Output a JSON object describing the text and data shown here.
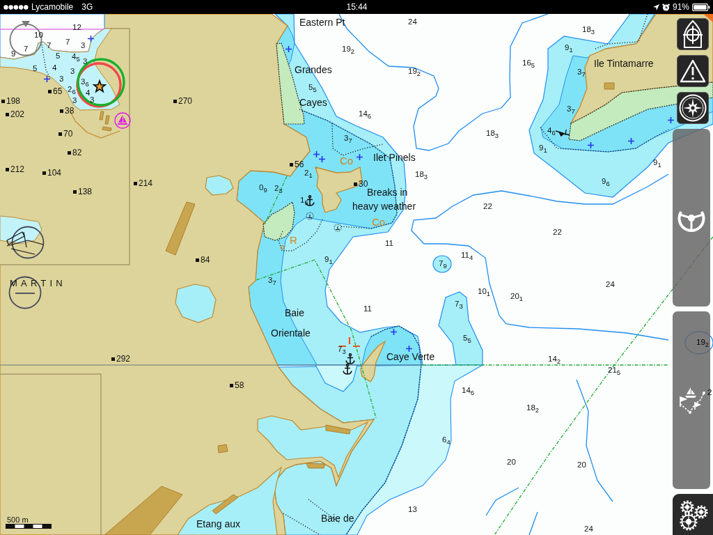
{
  "status_bar": {
    "carrier": "Lycamobile",
    "network": "3G",
    "time": "15:44",
    "battery": "91%"
  },
  "chart": {
    "place_names": [
      "Eastern Pt",
      "Grandes",
      "Cayes",
      "Ilet Pinels",
      "Breaks in",
      "heavy weather",
      "Ile Tintamarre",
      "Baie",
      "Orientale",
      "Caye Verte",
      "Etang aux",
      "Baie de"
    ],
    "area_name": "MARTIN",
    "seabed_labels": [
      "Co",
      "Co",
      "R"
    ],
    "spot_heights": [
      "270",
      "214",
      "56",
      "30",
      "84",
      "292",
      "58",
      "65",
      "38",
      "198",
      "202",
      "70",
      "82",
      "212",
      "104",
      "138"
    ],
    "soundings": [
      "24",
      "19$_{2}$",
      "19$_{2}$",
      "16$_{5}$",
      "18$_{3}$",
      "9$_{1}$",
      "3$_{7}$",
      "3$_{7}$",
      "4$_{6}$",
      "9$_{1}$",
      "9$_{1}$",
      "9$_{6}$",
      "18$_{3}$",
      "14$_{6}$",
      "5$_{5}$",
      "3$_{7}$",
      "18$_{3}$",
      "2$_{1}$",
      "0$_{9}$",
      "2$_{3}$",
      "1$_{5}$",
      "22",
      "22",
      "11",
      "9$_{1}$",
      "11$_{4}$",
      "7$_{9}$",
      "10$_{1}$",
      "20$_{1}$",
      "24",
      "3$_{7}$",
      "11",
      "7$_{3}$",
      "5$_{5}$",
      "7$_{3}$",
      "14$_{2}$",
      "21$_{5}$",
      "14$_{6}$",
      "18$_{2}$",
      "6$_{4}$",
      "20",
      "20",
      "13",
      "24",
      "19$_{2}$",
      "2",
      "12",
      "10",
      "7",
      "7",
      "7",
      "9",
      "3",
      "5",
      "4$_{5}$",
      "3",
      "5",
      "4",
      "3",
      "3",
      "3$_{6}$",
      "2$_{6}$",
      "4",
      "3",
      "3"
    ],
    "scale_bar": {
      "label": "500 m"
    }
  },
  "toolbar": {
    "buttons": [
      {
        "kind": "position"
      },
      {
        "kind": "warning"
      },
      {
        "kind": "compass"
      },
      {
        "kind": "helm"
      },
      {
        "kind": "route"
      },
      {
        "kind": "settings"
      }
    ]
  }
}
